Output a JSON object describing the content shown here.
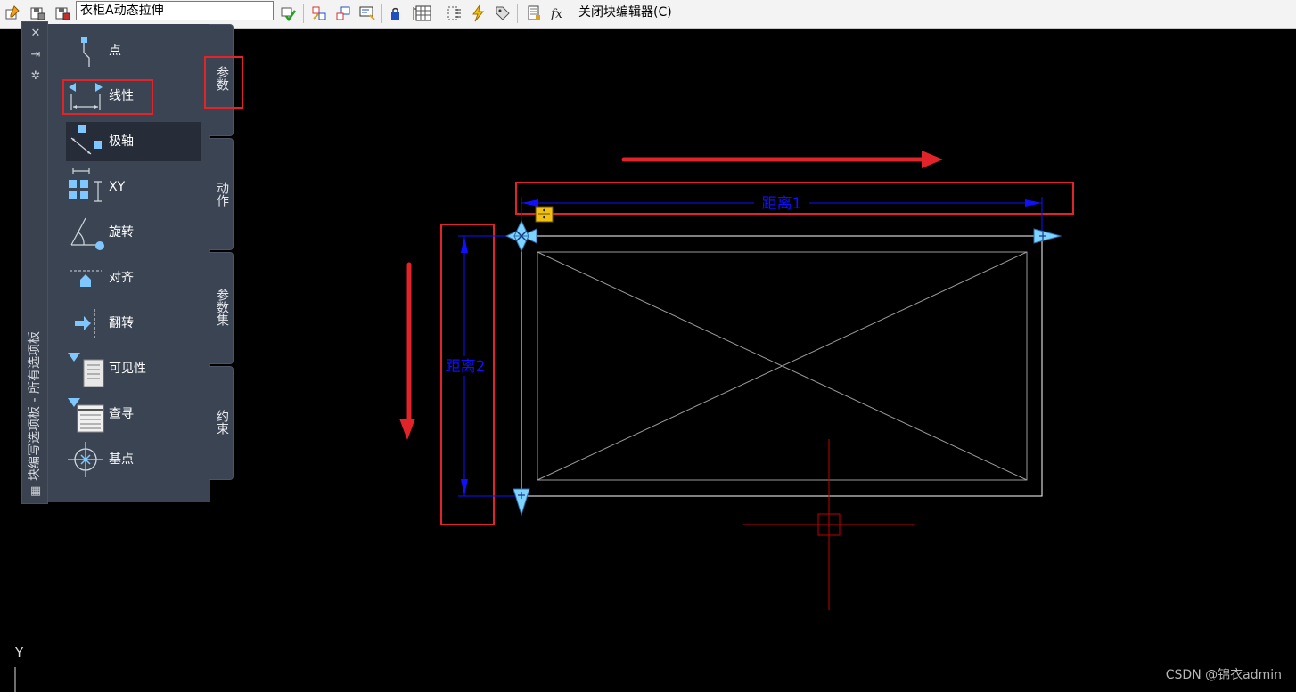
{
  "toolbar": {
    "block_name": "衣柜A动态拉伸",
    "close_label": "关闭块编辑器(C)",
    "icons": [
      "edit-block-icon",
      "save-block-icon",
      "save-block-as-icon",
      "test-block-icon",
      "auth-params-icon",
      "auth-actions-icon",
      "attribute-definition-icon",
      "constraint-icon",
      "block-table-icon",
      "parameter-manager-icon",
      "action-lightning-icon",
      "point-tag-icon",
      "block-properties-icon",
      "fx-icon"
    ]
  },
  "palette": {
    "title": "块编写选项板 - 所有选项板",
    "strip_icons": [
      "close-icon",
      "auto-hide-icon",
      "properties-icon",
      "palette-menu-icon"
    ],
    "tools": [
      {
        "label": "点",
        "icon": "point-parameter-icon"
      },
      {
        "label": "线性",
        "icon": "linear-parameter-icon"
      },
      {
        "label": "极轴",
        "icon": "polar-parameter-icon"
      },
      {
        "label": "XY",
        "icon": "xy-parameter-icon"
      },
      {
        "label": "旋转",
        "icon": "rotation-parameter-icon"
      },
      {
        "label": "对齐",
        "icon": "alignment-parameter-icon"
      },
      {
        "label": "翻转",
        "icon": "flip-parameter-icon"
      },
      {
        "label": "可见性",
        "icon": "visibility-parameter-icon"
      },
      {
        "label": "查寻",
        "icon": "lookup-parameter-icon"
      },
      {
        "label": "基点",
        "icon": "basepoint-parameter-icon"
      }
    ],
    "tabs": [
      {
        "label": "参数",
        "selected": true
      },
      {
        "label": "动作",
        "selected": false
      },
      {
        "label": "参数集",
        "selected": false
      },
      {
        "label": "约束",
        "selected": false
      }
    ]
  },
  "drawing": {
    "dim1_label": "距离1",
    "dim2_label": "距离2",
    "ucs_label": "Y",
    "colors": {
      "dimension": "#1010ff",
      "annotation": "#e0242a",
      "geometry": "#ffffff",
      "inner": "#9a9a9a",
      "crosshair": "#c00000",
      "grip": "#7fd3ff"
    }
  },
  "watermark": "CSDN @锦衣admin"
}
